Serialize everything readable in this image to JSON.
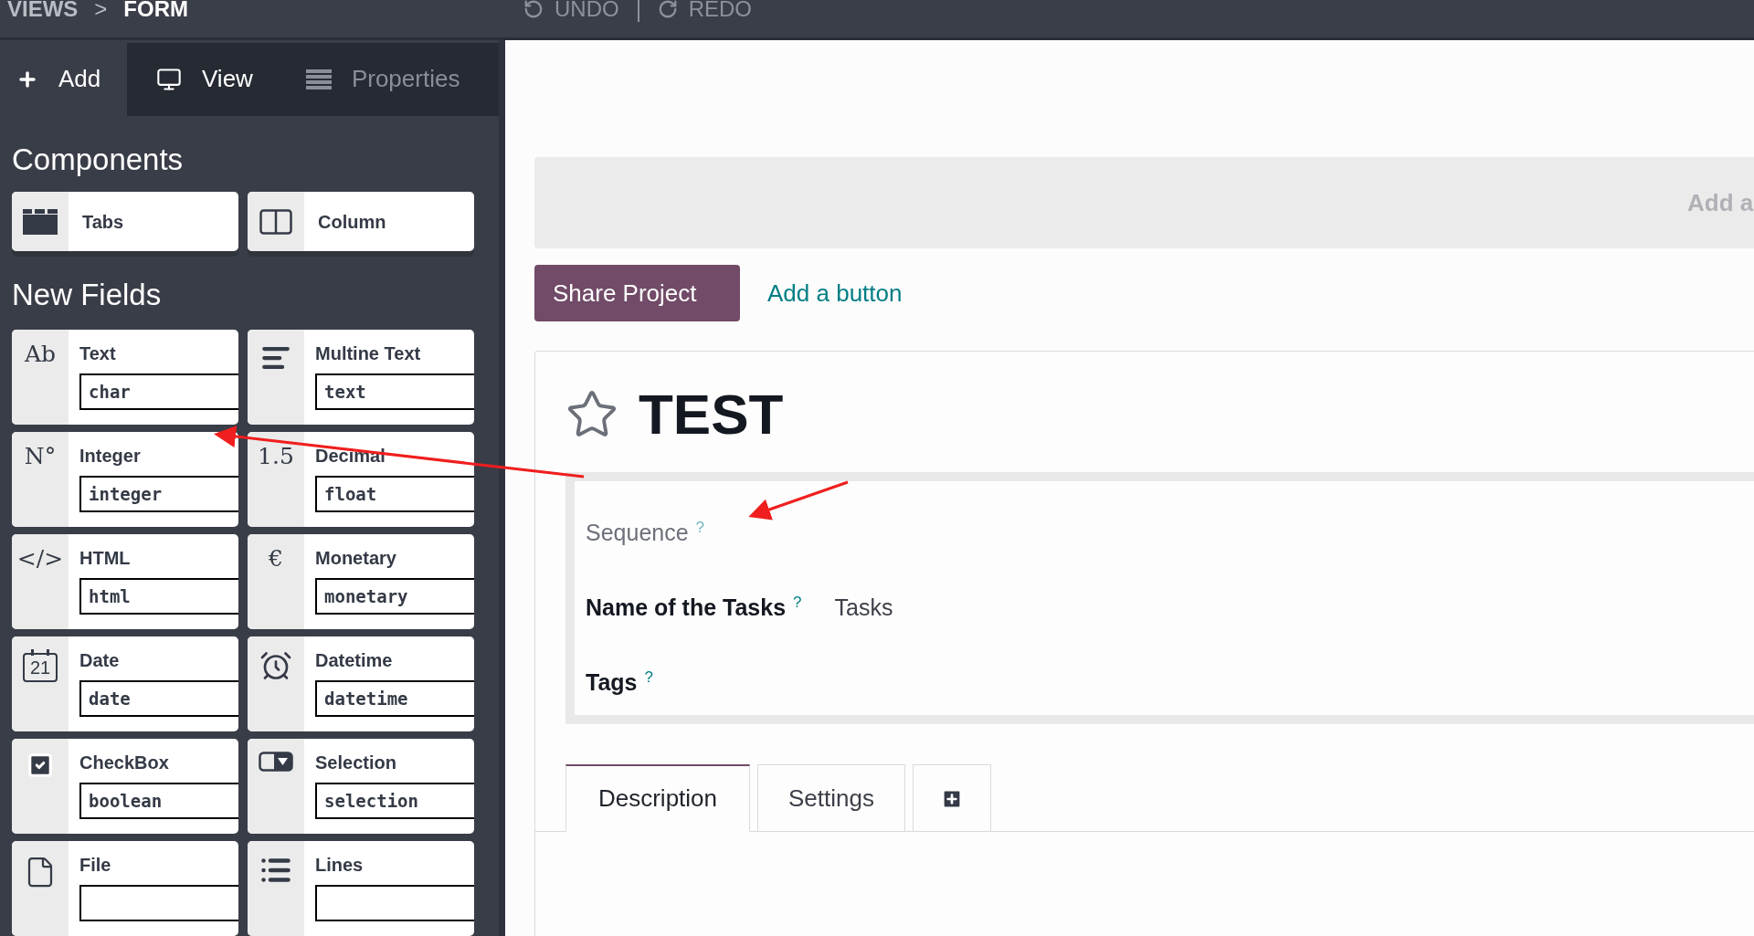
{
  "breadcrumb": {
    "items": [
      "VIEWS",
      "FORM"
    ],
    "separator": ">"
  },
  "history": [
    {
      "kind": "undo",
      "label": "UNDO"
    },
    {
      "kind": "redo",
      "label": "REDO"
    }
  ],
  "sidebar": {
    "tabs": [
      {
        "kind": "add",
        "label": "Add",
        "selected": true,
        "disabled": false
      },
      {
        "kind": "view",
        "label": "View",
        "selected": false,
        "disabled": false
      },
      {
        "kind": "properties",
        "label": "Properties",
        "selected": false,
        "disabled": true
      }
    ],
    "components_title": "Components",
    "components": [
      {
        "kind": "tabs",
        "label": "Tabs"
      },
      {
        "kind": "column",
        "label": "Column"
      }
    ],
    "fields_title": "New Fields",
    "fields": [
      {
        "kind": "glyph",
        "glyph": "Ab",
        "label": "Text",
        "type": "char"
      },
      {
        "kind": "lines",
        "label": "Multine Text",
        "type": "text"
      },
      {
        "kind": "glyph",
        "glyph": "N°",
        "label": "Integer",
        "type": "integer"
      },
      {
        "kind": "glyph",
        "glyph": "1.5",
        "label": "Decimal",
        "type": "float"
      },
      {
        "kind": "glyph",
        "glyph": "</>",
        "label": "HTML",
        "type": "html"
      },
      {
        "kind": "glyph",
        "glyph": "€",
        "label": "Monetary",
        "type": "monetary"
      },
      {
        "kind": "calendar",
        "glyph": "21",
        "label": "Date",
        "type": "date"
      },
      {
        "kind": "clock",
        "label": "Datetime",
        "type": "datetime"
      },
      {
        "kind": "checkbox",
        "label": "CheckBox",
        "type": "boolean"
      },
      {
        "kind": "select",
        "label": "Selection",
        "type": "selection"
      },
      {
        "kind": "file",
        "label": "File"
      },
      {
        "kind": "list",
        "label": "Lines"
      }
    ]
  },
  "header_bar": {
    "text": "Add a"
  },
  "buttons": [
    {
      "kind": "primary",
      "label": "Share Project"
    },
    {
      "kind": "link",
      "label": "Add a button"
    }
  ],
  "form": {
    "title": "TEST",
    "starred": false,
    "fields": [
      {
        "label": "Sequence",
        "help": "?",
        "muted": true
      },
      {
        "label": "Name of the Tasks",
        "help": "?",
        "muted": false,
        "value": "Tasks"
      },
      {
        "label": "Tags",
        "help": "?",
        "muted": false
      }
    ],
    "tabs": [
      {
        "kind": "text",
        "label": "Description",
        "selected": true
      },
      {
        "kind": "text",
        "label": "Settings",
        "selected": false
      },
      {
        "kind": "add",
        "selected": false
      }
    ]
  }
}
